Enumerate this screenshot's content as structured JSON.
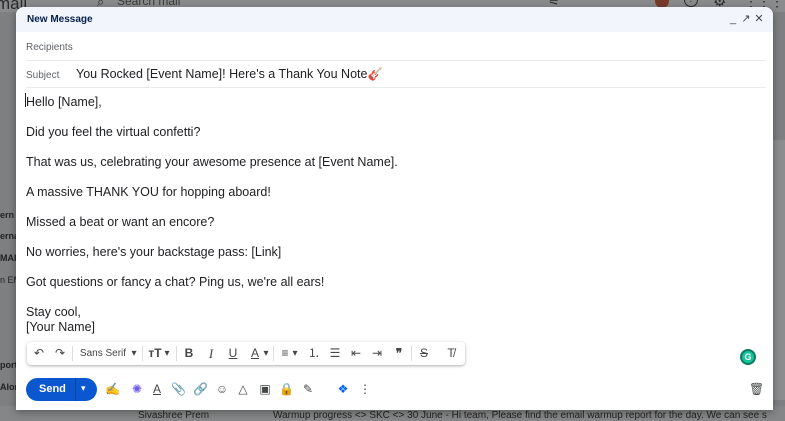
{
  "background": {
    "logo": "mail",
    "search_placeholder": "Search mail",
    "sidebar_fragments": [
      "ern",
      "erna",
      "MAIL",
      "n EM",
      "port",
      "Alon"
    ],
    "row": {
      "sender": "Sivashree Prem",
      "subject": "Warmup progress <> SKC <> 30 June - Hi team, Please find the email warmup report for the day. We can see s"
    }
  },
  "compose": {
    "title": "New Message",
    "header_icons": {
      "minimize": "_",
      "expand": "↗",
      "close": "✕"
    },
    "recipients_label": "Recipients",
    "subject_label": "Subject",
    "subject_value": "You Rocked [Event Name]! Here's a Thank You Note🎸",
    "body_lines": [
      "Hello [Name],",
      "Did you feel the virtual confetti?",
      "That was us, celebrating your awesome presence at [Event Name].",
      "A massive THANK YOU for hopping aboard!",
      "Missed a beat or want an encore?",
      "No worries, here's your backstage pass: [Link]",
      "Got questions or fancy a chat? Ping us, we're all ears!",
      "Stay cool,",
      "[Your Name]"
    ],
    "grammarly_badge": "G",
    "formatting": {
      "undo": "↶",
      "redo": "↷",
      "font": "Sans Serif",
      "font_caret": "▾",
      "size": "тT",
      "size_caret": "▾",
      "bold": "B",
      "italic": "I",
      "underline": "U",
      "text_color": "A",
      "text_color_caret": "▾",
      "align": "≡",
      "align_caret": "▾",
      "numbered_list": "⒈",
      "bulleted_list": "☰",
      "indent_less": "⇤",
      "indent_more": "⇥",
      "quote": "❞",
      "strikethrough": "S",
      "clear_formatting": "T̸"
    },
    "send_label": "Send",
    "send_more": "▾",
    "bottom_icons": {
      "signature": "✍",
      "ai_sparkle": "✺",
      "formatting_toggle": "A",
      "attach": "📎",
      "link": "🔗",
      "emoji": "☺",
      "drive": "△",
      "photo": "▣",
      "confidential": "🔒",
      "pen": "✎",
      "dropbox": "❖",
      "more": "⋮",
      "trash": "🗑"
    }
  }
}
